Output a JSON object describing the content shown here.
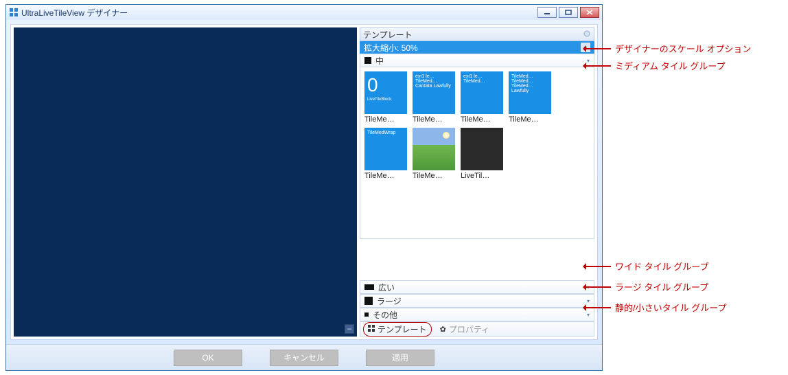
{
  "window": {
    "title": "UltraLiveTileView デザイナー"
  },
  "right_panel": {
    "header": "テンプレート",
    "zoom_label": "拡大縮小: 50%",
    "groups": {
      "medium": "中",
      "wide": "広い",
      "large": "ラージ",
      "other": "その他"
    },
    "tiles_row1": [
      {
        "thumb_text": "0",
        "sub_text": "LiveTileBlock",
        "label": "TileMe…",
        "style": "bigzero"
      },
      {
        "thumb_text": "ext1 le…\nTileMed…\nCantata\nLawfully",
        "label": "TileMe…",
        "style": ""
      },
      {
        "thumb_text": "ext1 le…\nTileMed…",
        "label": "TileMe…",
        "style": ""
      },
      {
        "thumb_text": "TileMed…\nTileMed…\nTileMed…\nLawfully",
        "label": "TileMe…",
        "style": ""
      }
    ],
    "tiles_row2": [
      {
        "thumb_text": "TileMedWrap",
        "label": "TileMe…",
        "style": ""
      },
      {
        "thumb_text": "",
        "label": "TileMe…",
        "style": "photo"
      },
      {
        "thumb_text": "",
        "label": "LiveTil…",
        "style": "dark"
      }
    ]
  },
  "tabs": {
    "template": "テンプレート",
    "properties": "プロパティ"
  },
  "buttons": {
    "ok": "OK",
    "cancel": "キャンセル",
    "apply": "適用"
  },
  "annotations": {
    "zoom": "デザイナーのスケール オプション",
    "medium": "ミディアム タイル グループ",
    "wide": "ワイド タイル グループ",
    "large": "ラージ タイル グループ",
    "other": "静的/小さいタイル グループ"
  }
}
